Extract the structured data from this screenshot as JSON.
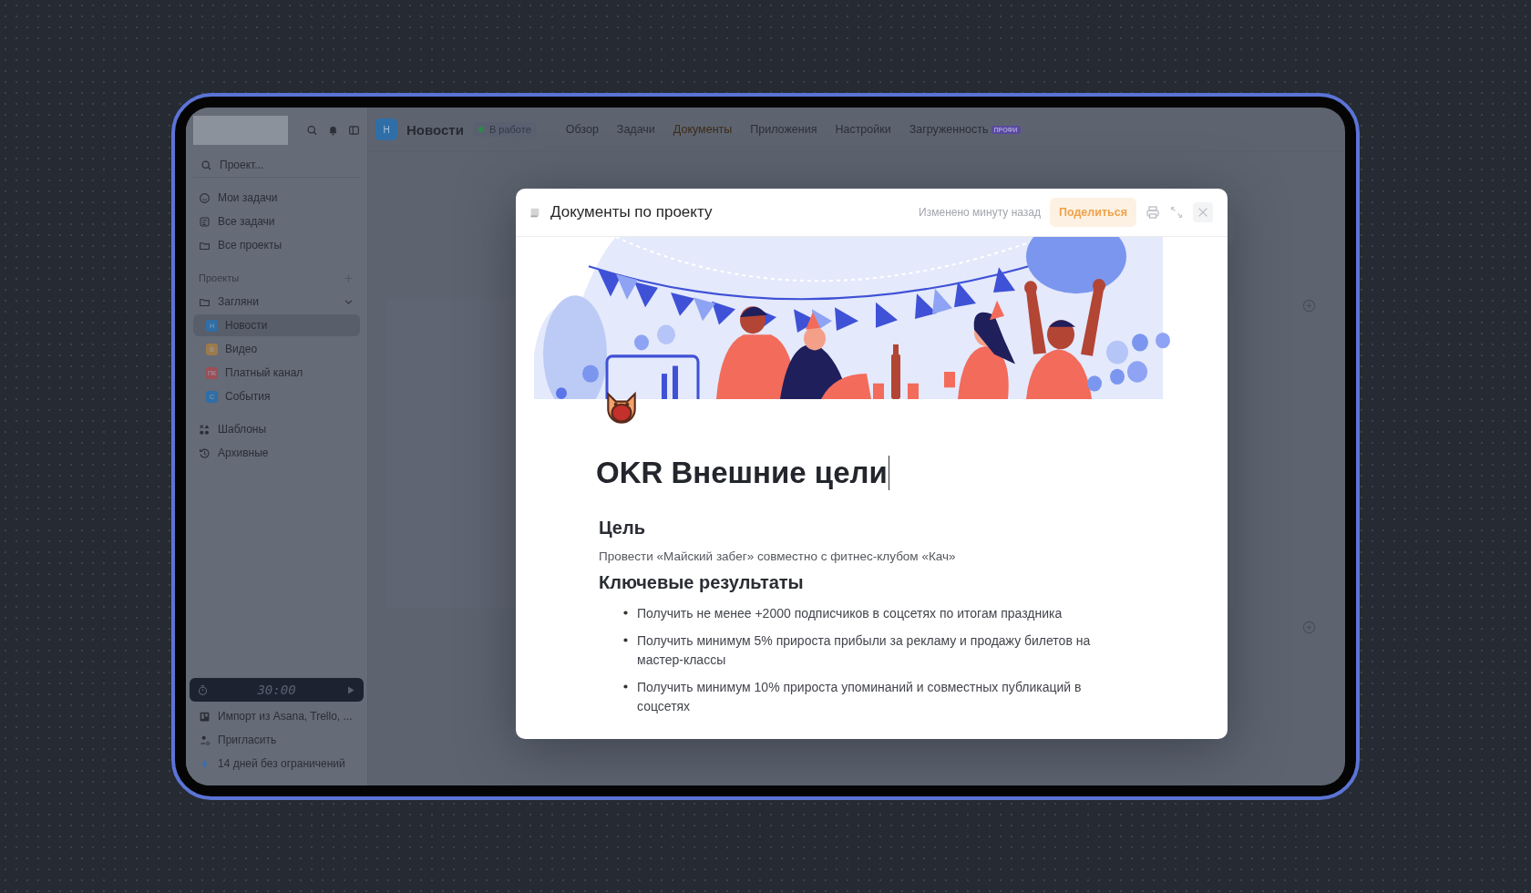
{
  "sidebar": {
    "search": {
      "placeholder": "Проект..."
    },
    "nav": [
      {
        "label": "Мои задачи"
      },
      {
        "label": "Все задачи"
      },
      {
        "label": "Все проекты"
      }
    ],
    "projects_header": "Проекты",
    "folder": {
      "label": "Загляни",
      "expanded": true,
      "projects": [
        {
          "badge": "Н",
          "label": "Новости",
          "color": "#2f6ea6",
          "selected": true
        },
        {
          "badge": "В",
          "label": "Видео",
          "color": "#9b7a4c",
          "selected": false
        },
        {
          "badge": "ПК",
          "label": "Платный канал",
          "color": "#9c4e57",
          "selected": false
        },
        {
          "badge": "С",
          "label": "События",
          "color": "#2f6ea6",
          "selected": false
        }
      ]
    },
    "extra": [
      {
        "label": "Шаблоны"
      },
      {
        "label": "Архивные"
      }
    ],
    "timer": "30:00",
    "bottom": [
      {
        "label": "Импорт из Asana, Trello, ..."
      },
      {
        "label": "Пригласить"
      },
      {
        "label": "14 дней без ограничений"
      }
    ]
  },
  "topbar": {
    "badge": "Н",
    "project": "Новости",
    "status": "В работе",
    "tabs": [
      {
        "label": "Обзор",
        "selected": false
      },
      {
        "label": "Задачи",
        "selected": false
      },
      {
        "label": "Документы",
        "selected": true
      },
      {
        "label": "Приложения",
        "selected": false
      },
      {
        "label": "Настройки",
        "selected": false
      },
      {
        "label": "Загруженность",
        "selected": false,
        "badge": "ПРОФИ"
      }
    ]
  },
  "modal": {
    "title": "Документы по проекту",
    "modified": "Изменено минуту назад",
    "share": "Поделиться",
    "document": {
      "title": "OKR Внешние цели",
      "blocks": [
        {
          "kind": "heading",
          "text": "Цель"
        },
        {
          "kind": "paragraph",
          "text": "Провести «Майский забег» совместно с фитнес-клубом «Кач»"
        },
        {
          "kind": "heading",
          "text": "Ключевые результаты"
        },
        {
          "kind": "bullet",
          "text": "Получить не менее +2000 подписчиков в соцсетях по итогам праздника"
        },
        {
          "kind": "bullet",
          "text": "Получить минимум 5% прироста прибыли за рекламу и продажу билетов на мастер-классы"
        },
        {
          "kind": "bullet",
          "text": "Получить минимум 10% прироста упоминаний и совместных публикаций в соцсетях"
        }
      ]
    }
  }
}
